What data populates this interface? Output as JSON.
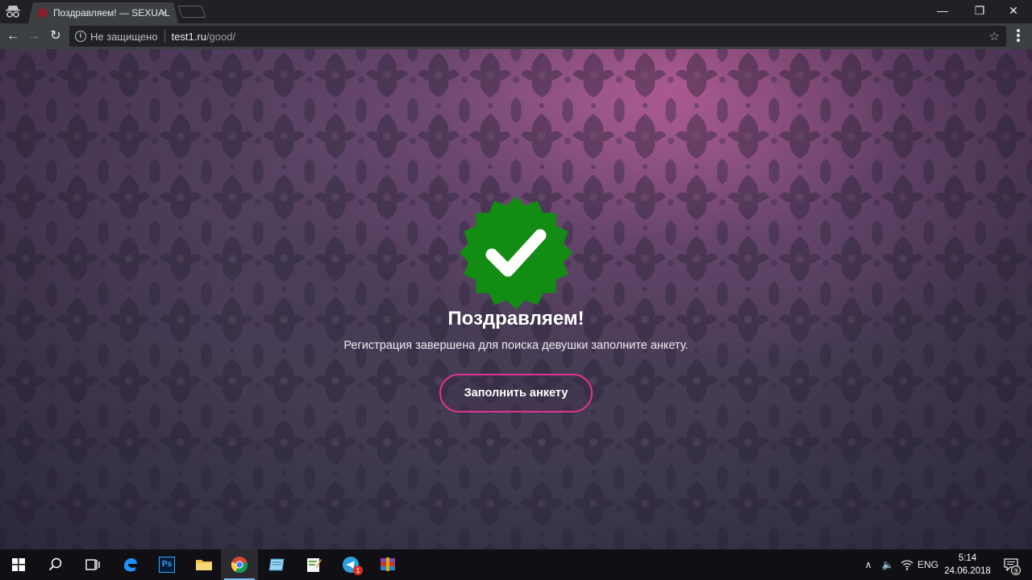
{
  "browser": {
    "tab_title": "Поздравляем! — SEXUAL",
    "tab_close": "×",
    "window_controls": {
      "minimize": "—",
      "maximize": "❐",
      "close": "✕"
    },
    "nav": {
      "back": "←",
      "forward": "→",
      "reload": "↻"
    },
    "omnibox": {
      "security_icon": "i",
      "security_text": "Не защищено",
      "url_host": "test1.ru",
      "url_path": "/good/",
      "bookmark_icon": "☆"
    }
  },
  "page": {
    "headline": "Поздравляем!",
    "subtext": "Регистрация завершена для поиска девушки заполните анкету.",
    "cta_label": "Заполнить анкету",
    "colors": {
      "badge": "#128c12",
      "cta_border": "#e0338f",
      "checkmark": "#ffffff"
    }
  },
  "taskbar": {
    "apps": [
      {
        "name": "start",
        "icon": "windows-logo-icon"
      },
      {
        "name": "search",
        "icon": "search-icon"
      },
      {
        "name": "task-view",
        "icon": "task-view-icon"
      },
      {
        "name": "edge",
        "icon": "edge-icon"
      },
      {
        "name": "photoshop",
        "icon": "photoshop-icon",
        "label": "Ps"
      },
      {
        "name": "file-explorer",
        "icon": "folder-icon"
      },
      {
        "name": "chrome",
        "icon": "chrome-icon",
        "active": true
      },
      {
        "name": "notepad",
        "icon": "notepad-icon"
      },
      {
        "name": "editor",
        "icon": "editor-icon"
      },
      {
        "name": "telegram",
        "icon": "telegram-icon",
        "badge": "1"
      },
      {
        "name": "winrar",
        "icon": "winrar-icon"
      }
    ],
    "tray": {
      "chevron": "∧",
      "volume_icon": "🔈",
      "network_icon": "wifi-icon",
      "language": "ENG",
      "time": "5:14",
      "date": "24.06.2018",
      "notifications_count": "3"
    }
  }
}
